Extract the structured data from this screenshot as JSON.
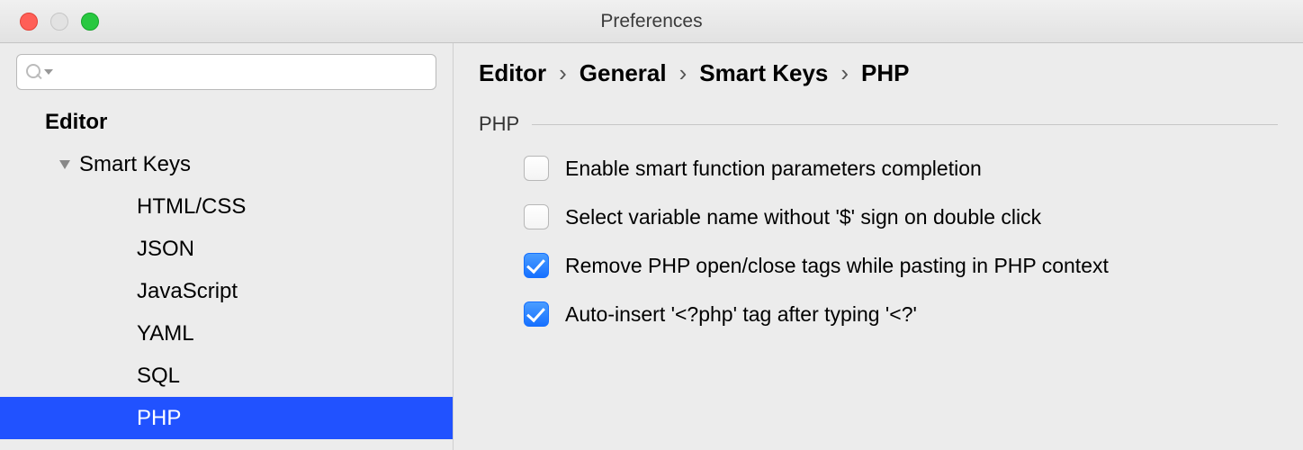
{
  "window": {
    "title": "Preferences"
  },
  "search": {
    "placeholder": ""
  },
  "sidebar": {
    "editor_label": "Editor",
    "smartkeys_label": "Smart Keys",
    "items": [
      {
        "label": "HTML/CSS",
        "selected": false
      },
      {
        "label": "JSON",
        "selected": false
      },
      {
        "label": "JavaScript",
        "selected": false
      },
      {
        "label": "YAML",
        "selected": false
      },
      {
        "label": "SQL",
        "selected": false
      },
      {
        "label": "PHP",
        "selected": true
      }
    ]
  },
  "breadcrumbs": [
    "Editor",
    "General",
    "Smart Keys",
    "PHP"
  ],
  "section_title": "PHP",
  "options": [
    {
      "label": "Enable smart function parameters completion",
      "checked": false
    },
    {
      "label": "Select variable name without '$' sign on double click",
      "checked": false
    },
    {
      "label": "Remove PHP open/close tags while pasting in PHP context",
      "checked": true
    },
    {
      "label": "Auto-insert '<?php' tag after typing '<?'",
      "checked": true
    }
  ]
}
